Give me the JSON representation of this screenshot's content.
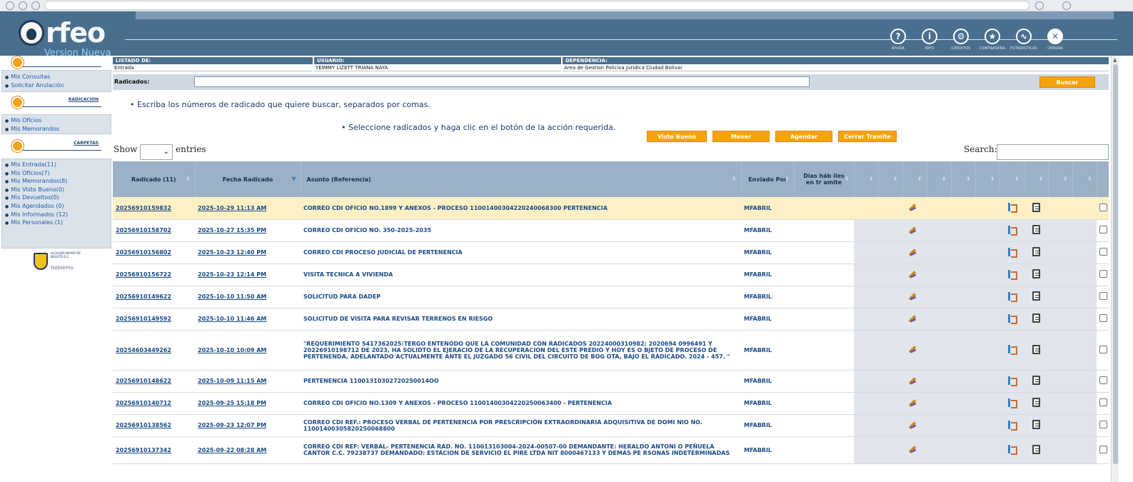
{
  "app": {
    "logo_text": "rfeo",
    "version_text": "Version Nueva"
  },
  "topnav": [
    {
      "label": "AYUDA",
      "glyph": "?"
    },
    {
      "label": "INFO",
      "glyph": "i"
    },
    {
      "label": "CREDITOS",
      "glyph": "⚙"
    },
    {
      "label": "CONTRASEÑA",
      "glyph": "★"
    },
    {
      "label": "ESTADISTICAS",
      "glyph": "∿"
    },
    {
      "label": "CERRAR",
      "glyph": "✕"
    }
  ],
  "sidebar": {
    "top_items": [
      "Mis Consultas",
      "Solicitar Anulación"
    ],
    "radicacion_title": "RADICACION",
    "radicacion_items": [
      "Mis Oficios",
      "Mis Memorandos"
    ],
    "carpetas_title": "CARPETAS",
    "carpetas_items": [
      "Mis Entrada(11)",
      "Mis Oficios(7)",
      "Mis Memorandos(8)",
      "Mis Visto Bueno(0)",
      "Mis Devueltos(0)",
      "Mis Agendados (0)",
      "Mis Informados (12)",
      "Mis Personales (1)"
    ],
    "gov_logo_text": "ALCALDÍA MAYOR DE BOGOTÁ D.C.",
    "gov_logo_sub": "Gobierno"
  },
  "info": {
    "listado_label": "LISTADO DE:",
    "listado_value": "Entrada",
    "usuario_label": "USUARIO:",
    "usuario_value": "YEIMMY LIZETT TRIANA NAYA",
    "dependencia_label": "DEPENDENCIA:",
    "dependencia_value": "Area de Gestion Policiva Juridica Ciudad Bolivar"
  },
  "search": {
    "radicados_label": "Radicados:",
    "buscar_label": "Buscar",
    "hint": "Escriba los números de radicado que quiere buscar, separados por comas.",
    "hint_actions": "Seleccione radicados y haga clic en el botón de la acción requerida."
  },
  "actions": [
    "Visto Bueno",
    "Mover",
    "Agendar",
    "Cerrar Tramite"
  ],
  "datatable": {
    "show_label": "Show",
    "entries_label": "entries",
    "search_label": "Search:"
  },
  "table": {
    "headers": {
      "radicado": "Radicado (11)",
      "fecha": "Fecha Radicado",
      "asunto": "Asunto (Referencia)",
      "enviado": "Enviado Por",
      "dias": "Dias háb iles en tr amite"
    },
    "rows": [
      {
        "radicado": "20256910159832",
        "fecha": "2025-10-29 11:13 AM",
        "asunto": "CORREO CDI OFICIO NO.1899 Y ANEXOS - PROCESO 11001400304220240068300 PERTENENCIA",
        "enviado": "MFABRIL"
      },
      {
        "radicado": "20256910158702",
        "fecha": "2025-10-27 15:35 PM",
        "asunto": "CORREO CDI OFICIO NO. 350-2025-2035",
        "enviado": "MFABRIL"
      },
      {
        "radicado": "20256910156802",
        "fecha": "2025-10-23 12:40 PM",
        "asunto": "CORREO CDI PROCESO JUDICIAL DE PERTENENCIA",
        "enviado": "MFABRIL"
      },
      {
        "radicado": "20256910156722",
        "fecha": "2025-10-23 12:14 PM",
        "asunto": "VISITA TECNICA A VIVIENDA",
        "enviado": "MFABRIL"
      },
      {
        "radicado": "20256910149622",
        "fecha": "2025-10-10 11:50 AM",
        "asunto": "SOLICITUD PARA DADEP",
        "enviado": "MFABRIL"
      },
      {
        "radicado": "20256910149592",
        "fecha": "2025-10-10 11:46 AM",
        "asunto": "SOLICITUD DE VISITA PARA REVISAR TERRENOS EN RIESGO",
        "enviado": "MFABRIL"
      },
      {
        "radicado": "20254603449262",
        "fecha": "2025-10-10 10:09 AM",
        "asunto": "\"REQUERIMIENTO 5417362025:TERGO ENTENODO QUE LA COMUNIDAD CON RADICADOS 20224000310982; 2020694 0996491 Y 20226910198712 DE 2023, HA SOLIDTO EL EJERACIO DE LA RECUPERACION DEL ESTE PREDIO Y HOY ES O BJETO DE PROCESO DE PERTENENDA, ADELANTADO ACTUALMENTE ANTE EL JUZGADO 56 CIVIL DEL CIRCUITO DE BOG OTA, BAJO EL RADICADO. 2024 - 457. \"",
        "enviado": "MFABRIL"
      },
      {
        "radicado": "20256910148622",
        "fecha": "2025-10-09 11:15 AM",
        "asunto": "PERTENENCIA 11001310302720250014OO",
        "enviado": "MFABRIL"
      },
      {
        "radicado": "20256910140712",
        "fecha": "2025-09-25 15:18 PM",
        "asunto": "CORREO CDI OFICIO NO.1309 Y ANEXOS - PROCESO 11001400304220250063400 - PERTENENCIA",
        "enviado": "MFABRIL"
      },
      {
        "radicado": "20256910138562",
        "fecha": "2025-09-23 12:07 PM",
        "asunto": "CORREO CDI REF.: PROCESO VERBAL DE PERTENENCIA POR PRESCRIPCIÓN EXTRAORDINARIA ADQUISITIVA DE DOMI NIO NO. 11001400305820250068800",
        "enviado": "MFABRIL"
      },
      {
        "radicado": "20256910137342",
        "fecha": "2025-09-22 08:28 AM",
        "asunto": "CORREO CDI REF: VERBAL- PERTENENCIA RAD. NO. 110013103004-2024-00507-00 DEMANDANTE: HERALDO ANTONI O PEÑUELA CANTOR C.C. 79238737 DEMANDADO: ESTACION DE SERVICIO EL PIRE LTDA NIT 8000467133 Y DEMÁS PE RSONAS INDETERMINADAS",
        "enviado": "MFABRIL"
      }
    ]
  }
}
